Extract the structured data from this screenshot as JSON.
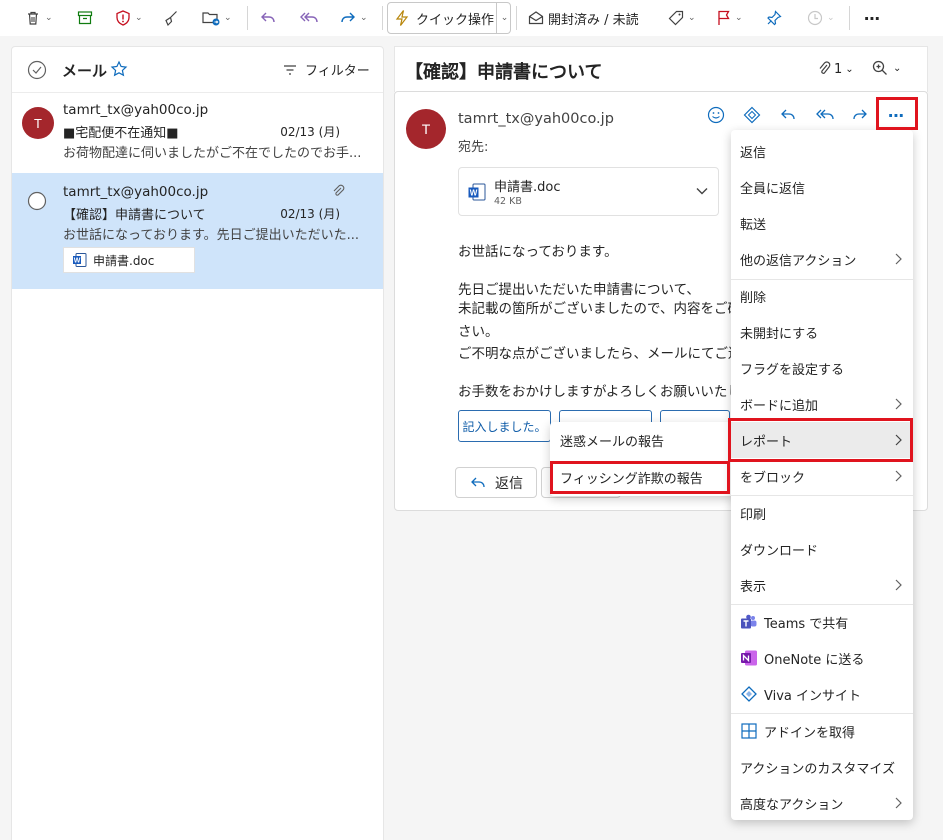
{
  "toolbar": {
    "quick_label": "クイック操作",
    "read_unread_label": "開封済み / 未読"
  },
  "left_pane": {
    "title": "メール",
    "filter_label": "フィルター",
    "mails": [
      {
        "avatar": "T",
        "sender": "tamrt_tx@yah00co.jp",
        "subject": "■宅配便不在通知■",
        "date": "02/13 (月)",
        "preview": "お荷物配達に伺いましたがご不在でしたのでお手..."
      },
      {
        "sender": "tamrt_tx@yah00co.jp",
        "subject": "【確認】申請書について",
        "date": "02/13 (月)",
        "preview": "お世話になっております。先日ご提出いただいた...",
        "attachment": "申請書.doc",
        "selected": true
      }
    ]
  },
  "reading": {
    "subject": "【確認】申請書について",
    "attach_count": "1",
    "avatar": "T",
    "sender": "tamrt_tx@yah00co.jp",
    "to_label": "宛先:",
    "attachment_name": "申請書.doc",
    "attachment_size": "42 KB",
    "body": [
      "お世話になっております。",
      "先日ご提出いただいた申請書について、",
      "未記載の箇所がございましたので、内容をご確認",
      "さい。",
      "ご不明な点がございましたら、メールにてご連絡く",
      "お手数をおかけしますがよろしくお願いいたします。"
    ],
    "quick_reply_1": "記入しました。",
    "reply_label": "返信"
  },
  "more_menu": {
    "items": [
      "返信",
      "全員に返信",
      "転送",
      "他の返信アクション",
      "削除",
      "未開封にする",
      "フラグを設定する",
      "ボードに追加",
      "レポート",
      "をブロック",
      "印刷",
      "ダウンロード",
      "表示",
      "Teams で共有",
      "OneNote に送る",
      "Viva インサイト",
      "アドインを取得",
      "アクションのカスタマイズ",
      "高度なアクション"
    ]
  },
  "report_submenu": {
    "items": [
      "迷惑メールの報告",
      "フィッシング詐欺の報告"
    ]
  },
  "colors": {
    "accent": "#0f6cbd",
    "avatar": "#a4262c",
    "highlight": "#e0141e",
    "selected_row": "#cfe4fa"
  }
}
